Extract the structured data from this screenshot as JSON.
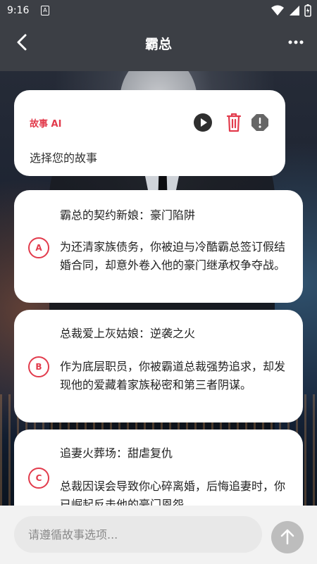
{
  "status_bar": {
    "time": "9:16",
    "sim_label": "A"
  },
  "app_bar": {
    "title": "霸总"
  },
  "ai_message": {
    "label": "故事 AI",
    "text": "选择您的故事"
  },
  "options": [
    {
      "badge": "A",
      "title": "霸总的契约新娘：豪门陷阱",
      "description": "为还清家族债务，你被迫与冷酷霸总签订假结婚合同，却意外卷入他的豪门继承权争夺战。"
    },
    {
      "badge": "B",
      "title": "总裁爱上灰姑娘：逆袭之火",
      "description": "作为底层职员，你被霸道总裁强势追求，却发现他的爱藏着家族秘密和第三者阴谋。"
    },
    {
      "badge": "C",
      "title": "追妻火葬场：甜虐复仇",
      "description": "总裁因误会导致你心碎离婚，后悔追妻时，你已崛起反击他的豪门恩怨"
    }
  ],
  "composer": {
    "placeholder": "请遵循故事选项..."
  },
  "colors": {
    "accent": "#e23b4c",
    "header": "#3c3f45"
  }
}
